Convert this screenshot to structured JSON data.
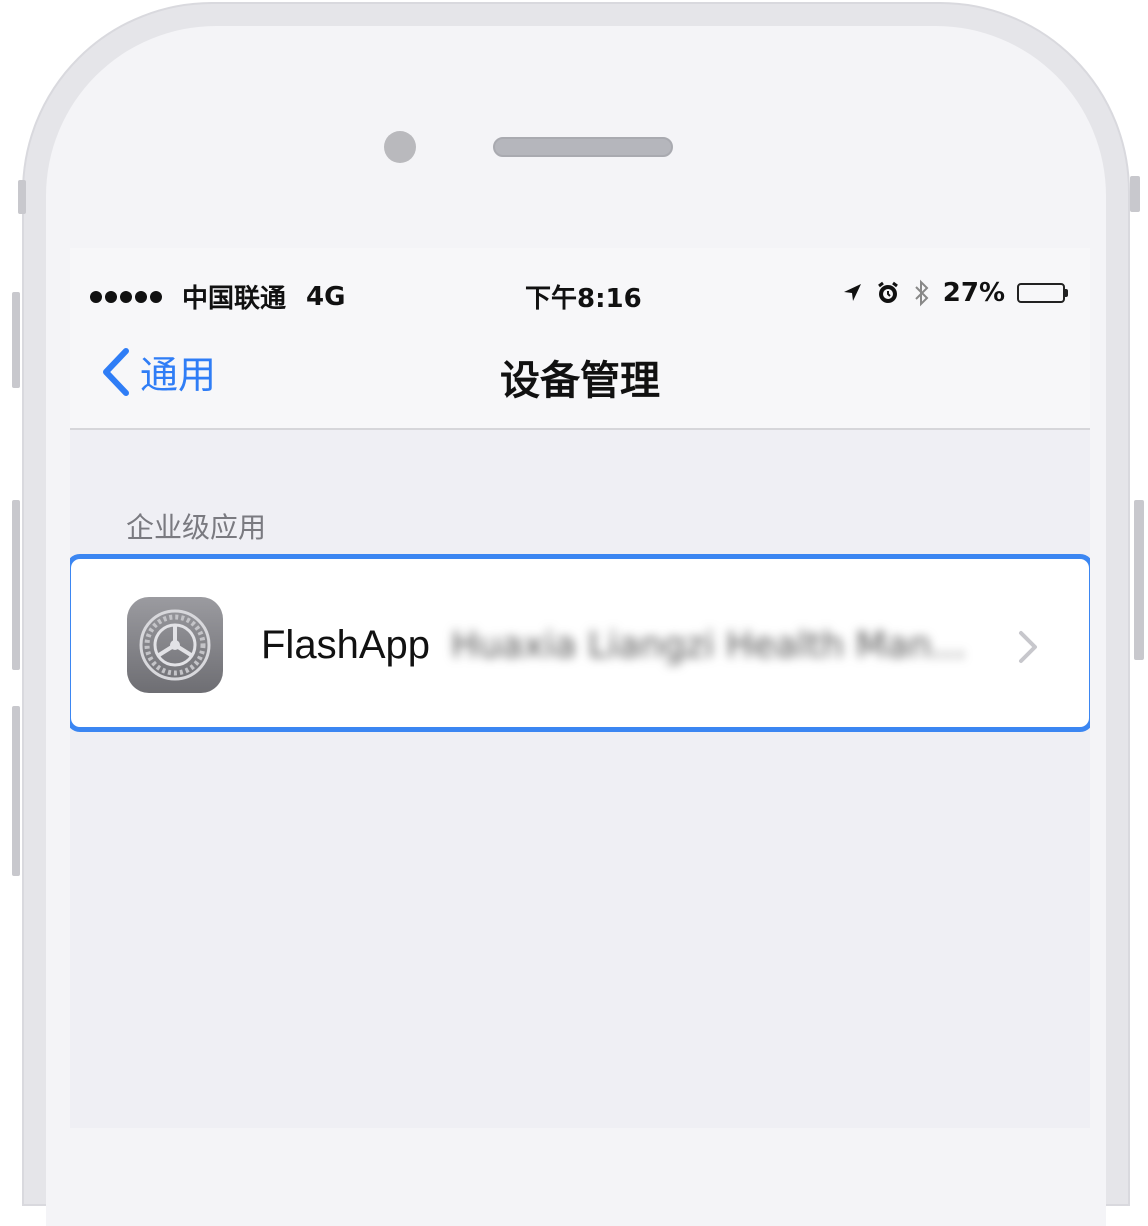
{
  "status_bar": {
    "carrier": "中国联通",
    "network": "4G",
    "time": "下午8:16",
    "battery_percent": "27%",
    "battery_level": 0.27
  },
  "nav": {
    "back_label": "通用",
    "title": "设备管理"
  },
  "section": {
    "header": "企业级应用",
    "row": {
      "app_name": "FlashApp",
      "cert_name": "Huaxia Liangzi Health Man..."
    }
  },
  "colors": {
    "accent": "#2f7df6",
    "highlight_border": "#3b86f2"
  },
  "icons": [
    "chevron-left-icon",
    "location-arrow-icon",
    "alarm-icon",
    "bluetooth-icon",
    "battery-icon",
    "settings-gear-icon",
    "chevron-right-icon"
  ]
}
